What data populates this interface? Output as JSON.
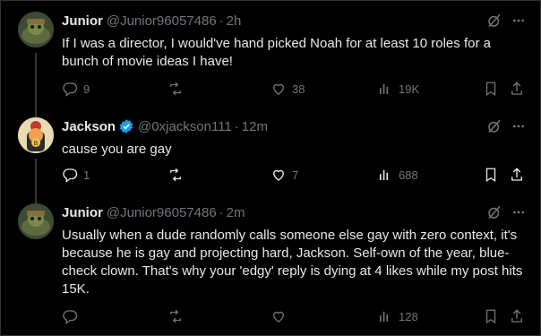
{
  "tweets": [
    {
      "name": "Junior",
      "handle": "@Junior96057486",
      "time": "2h",
      "text": "If I was a director, I would've hand picked Noah for at least 10 roles for a bunch of movie ideas I have!",
      "reply_count": "9",
      "retweet_count": "",
      "like_count": "38",
      "view_count": "19K",
      "verified": false
    },
    {
      "name": "Jackson",
      "handle": "@0xjackson111",
      "time": "12m",
      "text": "cause you are gay",
      "reply_count": "1",
      "retweet_count": "",
      "like_count": "7",
      "view_count": "688",
      "verified": true
    },
    {
      "name": "Junior",
      "handle": "@Junior96057486",
      "time": "2m",
      "text": "Usually when a dude randomly calls someone else gay with zero context, it's because he is gay and projecting hard, Jackson. Self-own of the year, blue-check clown. That's why your 'edgy' reply is dying at 4 likes while my post hits 15K.",
      "reply_count": "",
      "retweet_count": "",
      "like_count": "",
      "view_count": "128",
      "verified": false
    }
  ],
  "separator": "·",
  "icons": {
    "grok": "grok-icon",
    "more": "more-icon",
    "reply": "reply-icon",
    "retweet": "retweet-icon",
    "like": "like-icon",
    "views": "views-icon",
    "bookmark": "bookmark-icon",
    "share": "share-icon",
    "verified": "verified-badge-icon"
  },
  "colors": {
    "background": "#000000",
    "text": "#e7e9ea",
    "muted": "#71767b",
    "verified": "#1d9bf0",
    "divider": "#2f3336"
  }
}
